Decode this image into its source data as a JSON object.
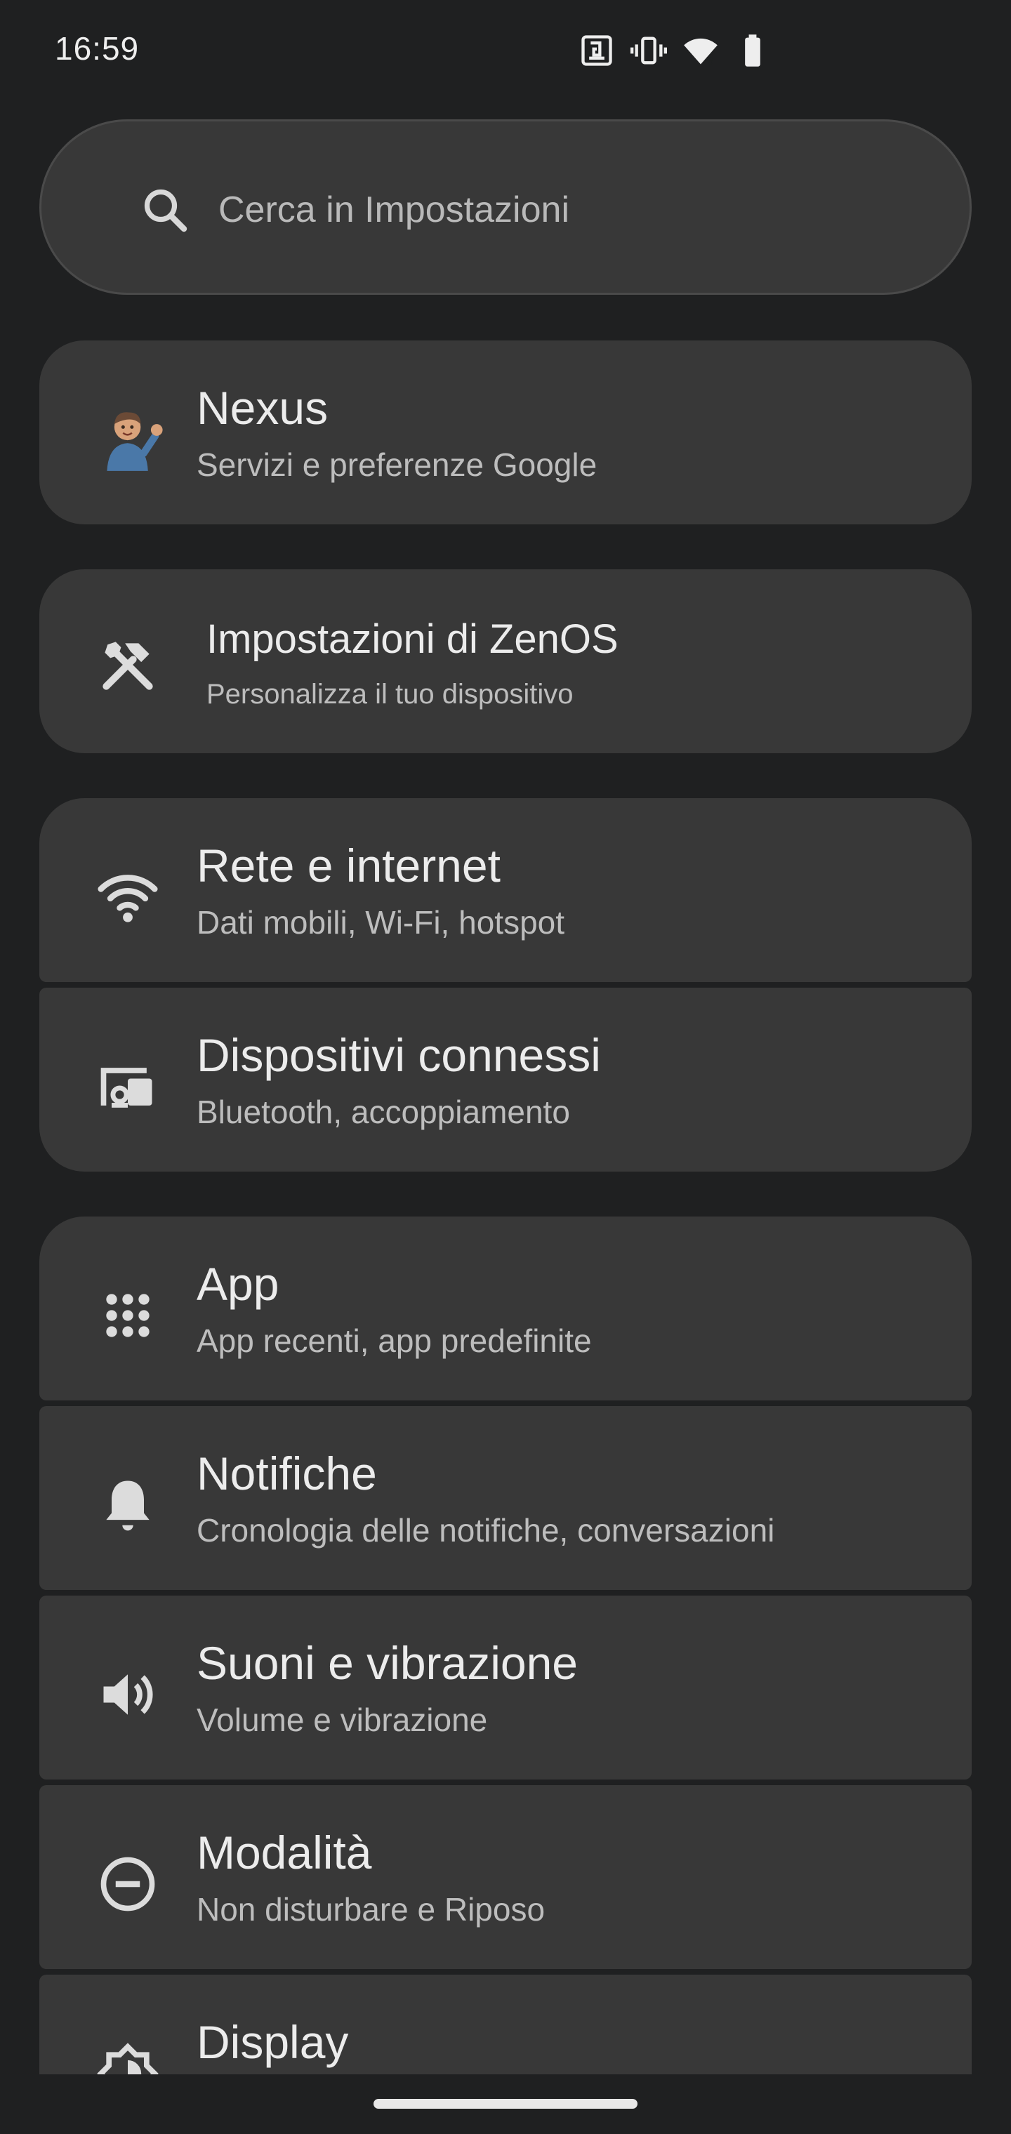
{
  "status_bar": {
    "time": "16:59",
    "icons": [
      "nfc-icon",
      "vibrate-icon",
      "wifi-icon",
      "battery-icon"
    ]
  },
  "search": {
    "placeholder": "Cerca in Impostazioni",
    "icon": "search-icon"
  },
  "items": [
    {
      "id": "nexus",
      "icon": "avatar",
      "title": "Nexus",
      "subtitle": "Servizi e preferenze Google"
    },
    {
      "id": "zenos",
      "icon": "tools-icon",
      "title": "Impostazioni di ZenOS",
      "subtitle": "Personalizza il tuo dispositivo"
    },
    {
      "id": "network",
      "icon": "wifi-icon",
      "title": "Rete e internet",
      "subtitle": "Dati mobili, Wi-Fi, hotspot"
    },
    {
      "id": "devices",
      "icon": "connected-devices-icon",
      "title": "Dispositivi connessi",
      "subtitle": "Bluetooth, accoppiamento"
    },
    {
      "id": "apps",
      "icon": "apps-grid-icon",
      "title": "App",
      "subtitle": "App recenti, app predefinite"
    },
    {
      "id": "notifications",
      "icon": "bell-icon",
      "title": "Notifiche",
      "subtitle": "Cronologia delle notifiche, conversazioni"
    },
    {
      "id": "sound",
      "icon": "volume-icon",
      "title": "Suoni e vibrazione",
      "subtitle": "Volume e vibrazione"
    },
    {
      "id": "modes",
      "icon": "do-not-disturb-icon",
      "title": "Modalità",
      "subtitle": "Non disturbare e Riposo"
    },
    {
      "id": "display",
      "icon": "brightness-icon",
      "title": "Display",
      "subtitle": ""
    }
  ],
  "colors": {
    "background": "#1f2021",
    "card": "#383838",
    "text_primary": "#ececec",
    "text_secondary": "#bdbdbd"
  }
}
